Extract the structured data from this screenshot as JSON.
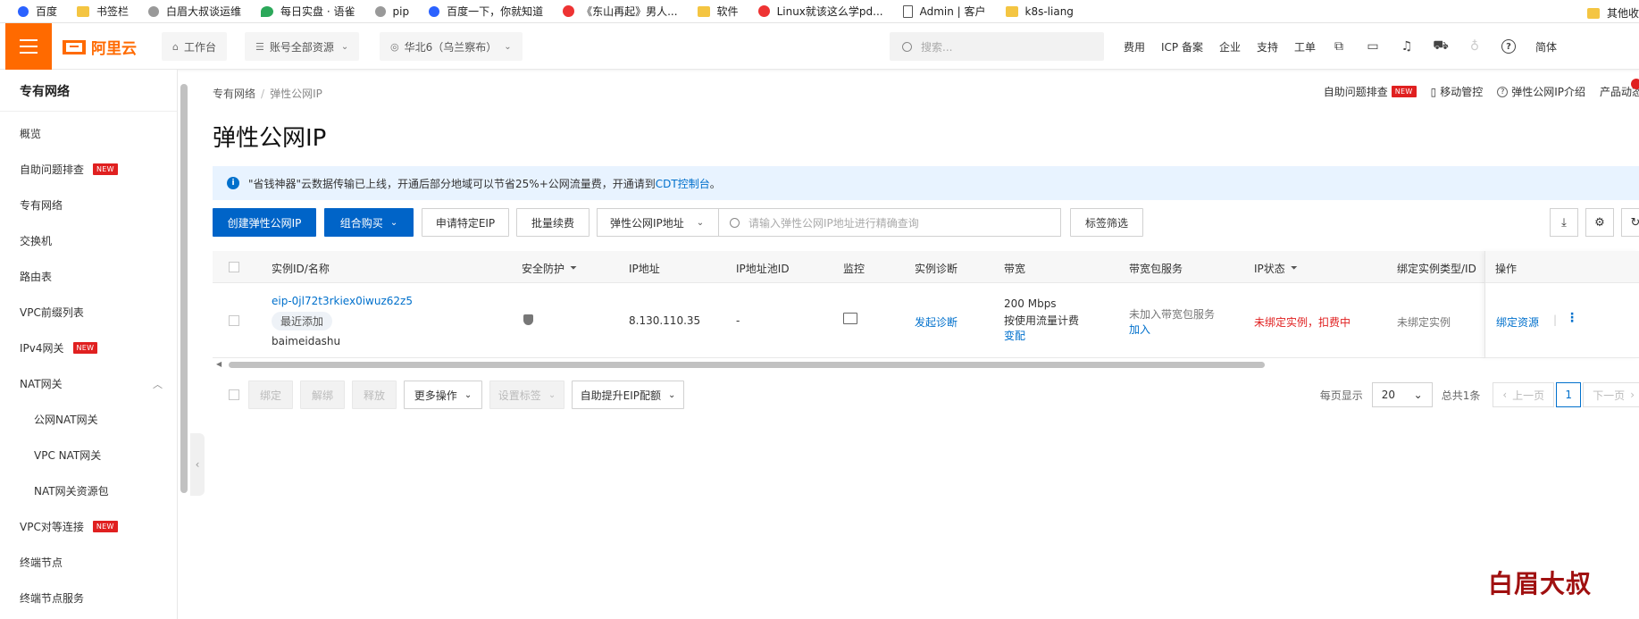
{
  "bookmarks": [
    {
      "label": "百度",
      "icon": "baidu-paw-icon"
    },
    {
      "label": "书签栏",
      "icon": "folder-icon"
    },
    {
      "label": "白眉大叔谈运维",
      "icon": "person-icon"
    },
    {
      "label": "每日实盘 · 语雀",
      "icon": "yuque-icon"
    },
    {
      "label": "pip",
      "icon": "person-icon"
    },
    {
      "label": "百度一下，你就知道",
      "icon": "baidu-paw-icon"
    },
    {
      "label": "《东山再起》男人...",
      "icon": "video-icon"
    },
    {
      "label": "软件",
      "icon": "folder-icon"
    },
    {
      "label": "Linux就该这么学pd...",
      "icon": "redhat-icon"
    },
    {
      "label": "Admin | 客户",
      "icon": "doc-icon"
    },
    {
      "label": "k8s-liang",
      "icon": "folder-icon"
    }
  ],
  "bookmarks_other": "其他收",
  "topnav": {
    "logo": "阿里云",
    "workbench": "工作台",
    "account_resources": "账号全部资源",
    "region": "华北6（乌兰察布）",
    "search_placeholder": "搜索...",
    "links": [
      "费用",
      "ICP 备案",
      "企业",
      "支持",
      "工单"
    ],
    "lang": "简体"
  },
  "sidebar": {
    "title": "专有网络",
    "items": [
      {
        "label": "概览",
        "new": false,
        "sub": false
      },
      {
        "label": "自助问题排查",
        "new": true,
        "sub": false
      },
      {
        "label": "专有网络",
        "new": false,
        "sub": false
      },
      {
        "label": "交换机",
        "new": false,
        "sub": false
      },
      {
        "label": "路由表",
        "new": false,
        "sub": false
      },
      {
        "label": "VPC前缀列表",
        "new": false,
        "sub": false
      },
      {
        "label": "IPv4网关",
        "new": true,
        "sub": false
      },
      {
        "label": "NAT网关",
        "new": false,
        "sub": false,
        "expanded": true
      },
      {
        "label": "公网NAT网关",
        "new": false,
        "sub": true
      },
      {
        "label": "VPC NAT网关",
        "new": false,
        "sub": true
      },
      {
        "label": "NAT网关资源包",
        "new": false,
        "sub": true
      },
      {
        "label": "VPC对等连接",
        "new": true,
        "sub": false
      },
      {
        "label": "终端节点",
        "new": false,
        "sub": false
      },
      {
        "label": "终端节点服务",
        "new": false,
        "sub": false
      }
    ],
    "new_label": "NEW"
  },
  "main": {
    "breadcrumb": [
      "专有网络",
      "弹性公网IP"
    ],
    "top_actions": {
      "troubleshoot": "自助问题排查",
      "new_badge": "NEW",
      "mobile": "移动管控",
      "intro": "弹性公网IP介绍",
      "news": "产品动态"
    },
    "title": "弹性公网IP",
    "notice": {
      "text": "\"省钱神器\"云数据传输已上线，开通后部分地域可以节省25%+公网流量费，开通请到",
      "link": "CDT控制台",
      "tail": "。"
    },
    "toolbar": {
      "create": "创建弹性公网IP",
      "combo": "组合购买",
      "apply_specific": "申请特定EIP",
      "batch_renew": "批量续费",
      "filter_field": "弹性公网IP地址",
      "search_placeholder": "请输入弹性公网IP地址进行精确查询",
      "tag_filter": "标签筛选"
    },
    "table": {
      "headers": [
        "实例ID/名称",
        "安全防护",
        "IP地址",
        "IP地址池ID",
        "监控",
        "实例诊断",
        "带宽",
        "带宽包服务",
        "IP状态",
        "绑定实例类型/ID",
        "操作"
      ],
      "rows": [
        {
          "id": "eip-0jl72t3rkiex0iwuz62z5",
          "tag": "最近添加",
          "name": "baimeidashu",
          "ip": "8.130.110.35",
          "pool": "-",
          "diagnose": "发起诊断",
          "bandwidth": "200 Mbps",
          "billing": "按使用流量计费",
          "change": "变配",
          "pkg": "未加入带宽包服务",
          "pkg_join": "加入",
          "status": "未绑定实例，扣费中",
          "bind_type": "未绑定实例",
          "action": "绑定资源"
        }
      ]
    },
    "footer": {
      "bind": "绑定",
      "unbind": "解绑",
      "release": "释放",
      "more": "更多操作",
      "set_tags": "设置标签",
      "quota": "自助提升EIP配额",
      "per_page_label": "每页显示",
      "per_page": "20",
      "total": "总共1条",
      "prev": "上一页",
      "page": "1",
      "next": "下一页"
    }
  },
  "watermark": "白眉大叔"
}
